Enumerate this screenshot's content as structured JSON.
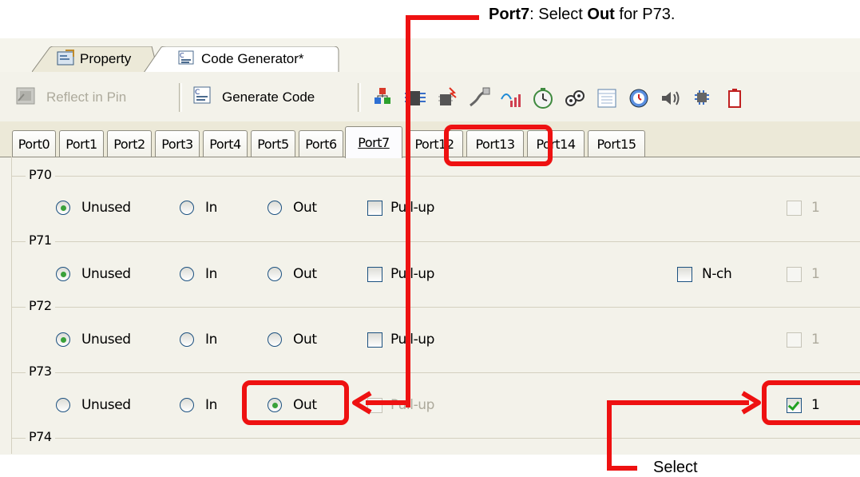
{
  "annotations": {
    "top_note_bold": "Port7",
    "top_note_text1": ": Select ",
    "top_note_bold2": "Out",
    "top_note_text2": " for P73.",
    "bottom_note": "Select",
    "color": "#ee1111"
  },
  "doc_tabs": [
    {
      "label": "Property",
      "icon": "property-icon"
    },
    {
      "label": "Code Generator*",
      "icon": "code-generator-icon"
    }
  ],
  "toolbar": {
    "reflect_label": "Reflect in Pin",
    "generate_label": "Generate Code",
    "icons": [
      "clock-gen-icon",
      "port-icon",
      "interrupt-icon",
      "serial-icon",
      "adc-icon",
      "timer-icon",
      "watchdog-icon",
      "rtc-icon",
      "interval-timer-icon",
      "buzzer-icon",
      "dma-icon",
      "battery-icon"
    ]
  },
  "port_tabs": [
    "Port0",
    "Port1",
    "Port2",
    "Port3",
    "Port4",
    "Port5",
    "Port6",
    "Port7",
    "Port12",
    "Port13",
    "Port14",
    "Port15"
  ],
  "active_port_tab": "Port7",
  "pins": [
    {
      "name": "P70",
      "unused": "Unused",
      "in": "In",
      "out": "Out",
      "pullup": "Pull-up",
      "nch": "",
      "value": "1",
      "selected": "unused",
      "output_checked": false
    },
    {
      "name": "P71",
      "unused": "Unused",
      "in": "In",
      "out": "Out",
      "pullup": "Pull-up",
      "nch": "N-ch",
      "value": "1",
      "selected": "unused",
      "output_checked": false
    },
    {
      "name": "P72",
      "unused": "Unused",
      "in": "In",
      "out": "Out",
      "pullup": "Pull-up",
      "nch": "",
      "value": "1",
      "selected": "unused",
      "output_checked": false
    },
    {
      "name": "P73",
      "unused": "Unused",
      "in": "In",
      "out": "Out",
      "pullup": "Pull-up",
      "nch": "",
      "value": "1",
      "selected": "out",
      "output_checked": true
    },
    {
      "name": "P74"
    }
  ]
}
